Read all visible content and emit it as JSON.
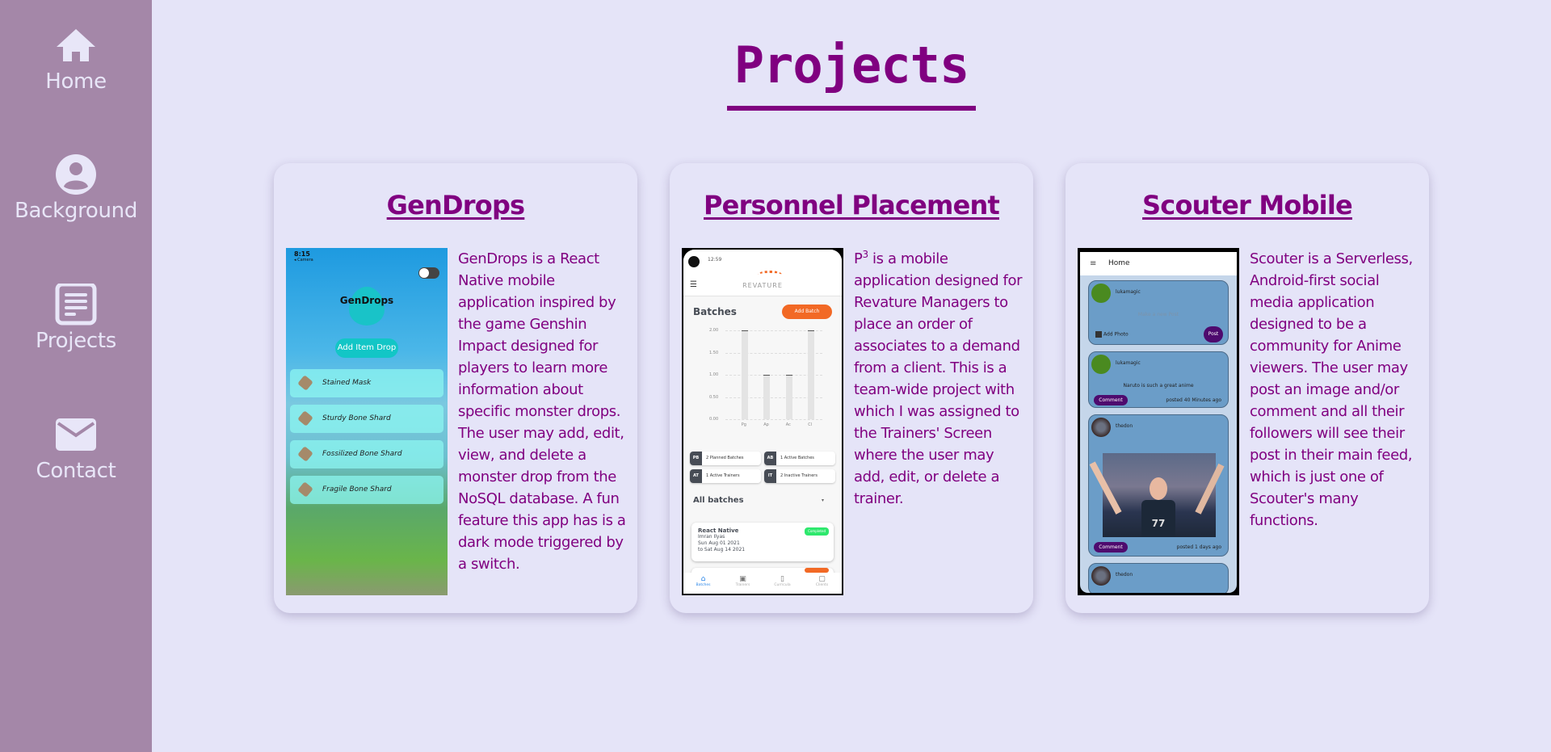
{
  "sidebar": {
    "items": [
      {
        "label": "Home",
        "icon": "home-icon"
      },
      {
        "label": "Background",
        "icon": "user-circle-icon"
      },
      {
        "label": "Projects",
        "icon": "document-icon"
      },
      {
        "label": "Contact",
        "icon": "mail-icon"
      }
    ]
  },
  "page": {
    "title": "Projects",
    "accent_color": "#800080",
    "sidebar_color": "#a487a8",
    "background_color": "#e5e4f8"
  },
  "projects": [
    {
      "title": "GenDrops",
      "description": "GenDrops is a React Native mobile application inspired by the game Genshin Impact designed for players to learn more information about specific monster drops. The user may add, edit, view, and delete a monster drop from the NoSQL database. A fun feature this app has is a dark mode triggered by a switch.",
      "screenshot": {
        "status_time": "8:15",
        "status_back": "◂ Camera",
        "app_name": "GenDrops",
        "add_button": "Add Item Drop",
        "items": [
          "Stained Mask",
          "Sturdy Bone Shard",
          "Fossilized Bone Shard",
          "Fragile Bone Shard"
        ]
      }
    },
    {
      "title": "Personnel Placement",
      "description_prefix": "P",
      "description_sup": "3",
      "description": " is a mobile application designed for Revature Managers to place an order of associates to a demand from a client. This is a team-wide project with which I was assigned to the Trainers' Screen where the user may add, edit, or delete a trainer.",
      "screenshot": {
        "status_time": "12:59",
        "brand": "REVATURE",
        "heading": "Batches",
        "add_button": "Add Batch",
        "chart": {
          "yticks": [
            "2.00",
            "1.50",
            "1.00",
            "0.50",
            "0.00"
          ],
          "values": [
            2,
            1,
            1,
            2
          ],
          "xticks": [
            "Pg",
            "Ap",
            "Ac",
            "Cl"
          ]
        },
        "stats": [
          {
            "code": "PB",
            "label": "2 Planned Batches"
          },
          {
            "code": "AB",
            "label": "1 Active Batches"
          },
          {
            "code": "AT",
            "label": "1 Active Trainers"
          },
          {
            "code": "IT",
            "label": "2 Inactive Trainers"
          }
        ],
        "all_batches": "All batches",
        "batch": {
          "title": "React Native",
          "trainer": "Imran Ilyas",
          "start": "Sun Aug 01 2021",
          "end": "to Sat Aug 14 2021",
          "status": "Completed"
        },
        "tabs": [
          "Batches",
          "Trainers",
          "Curricula",
          "Clients"
        ]
      }
    },
    {
      "title": "Scouter Mobile",
      "description": "Scouter is a Serverless, Android-first social media application designed to be a community for Anime viewers. The user may post an image and/or comment and all their followers will see their post in their main feed, which is just one of Scouter's many functions.",
      "screenshot": {
        "appbar_title": "Home",
        "new_post": {
          "user": "lukamagic",
          "placeholder": "Make a new Post",
          "add_photo": "Add Photo",
          "post_button": "Post"
        },
        "posts": [
          {
            "user": "lukamagic",
            "text": "Naruto is such a great anime",
            "comment_button": "Comment",
            "meta": "posted 40 Minutes ago"
          },
          {
            "user": "thedon",
            "comment_button": "Comment",
            "meta": "posted 1 days ago"
          },
          {
            "user": "thedon"
          }
        ]
      }
    }
  ]
}
